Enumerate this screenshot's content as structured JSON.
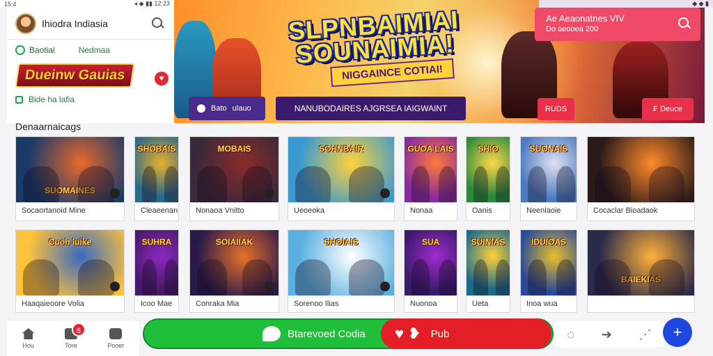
{
  "status_left": {
    "time": "15:4",
    "icons": "◂ ◆ ▮▮ 12:23"
  },
  "status_right": {
    "icons": "◆ ◆ ▮"
  },
  "header": {
    "app_title": "Ihiodra Indiasia"
  },
  "left_panel": {
    "row1_label": "Baotial",
    "row1_secondary": "Nedmaa",
    "logo_text": "Dueinw Gauias",
    "row3_label": "Bide ha lafia"
  },
  "hero": {
    "title_line1": "SLPNBAIMIAI",
    "title_line2": "SOUNAIMIA!",
    "subtitle": "NIGGAINCE COTIAI!",
    "tag_label": "Bato",
    "tag_secondary": "ulauo",
    "info_text": "NANUBODAIRES AJGRSEA IAIGWAINT",
    "button1_label": "RUDS",
    "button2_label": "Deuce",
    "accent_color": "#e8304a"
  },
  "right_search": {
    "line1": "Ae Aeaonatnes VIV",
    "line2": "Do aeooea 200"
  },
  "section_title": "Denaarnaicags",
  "cards_row1": [
    {
      "label": "Socaortanoid Mine",
      "thumb_title": "SUOMAINES"
    },
    {
      "label": "Cleaeenan",
      "thumb_title": "SHOBAIS"
    },
    {
      "label": "Nonaoa Vnitto",
      "thumb_title": "MOBAIS"
    },
    {
      "label": "Ueoeoka",
      "thumb_title": "SOHNBAIR"
    },
    {
      "label": "Nonaa",
      "thumb_title": "GUOA LAIS"
    },
    {
      "label": "Oanis",
      "thumb_title": "SHIO"
    },
    {
      "label": "Neenlaoie",
      "thumb_title": "SUONAIS"
    },
    {
      "label": "Cocaclar Bioadaok",
      "thumb_title": ""
    }
  ],
  "cards_row2": [
    {
      "label": "Haaqaieoore Volia",
      "thumb_title": "Cuoh luike"
    },
    {
      "label": "Icoo Mae",
      "thumb_title": "SUHRA"
    },
    {
      "label": "Conraka Mia",
      "thumb_title": "SOIAIIAK"
    },
    {
      "label": "Sorenoo Ilias",
      "thumb_title": "SHOIAIS"
    },
    {
      "label": "Nuonoa",
      "thumb_title": "SUA"
    },
    {
      "label": "Ueta",
      "thumb_title": "SUINIAS"
    },
    {
      "label": "Inoa wua",
      "thumb_title": "IDUIOAS"
    },
    {
      "label": "",
      "thumb_title": "BAIEKIAS"
    }
  ],
  "bottom_nav": {
    "home_label": "Hou",
    "tv_label": "Tore",
    "tv_badge": "8",
    "camera_label": "Pooer"
  },
  "cta": {
    "green_label": "Btarevoed Codia",
    "red_label": "Pub",
    "green_color": "#1fbf3a",
    "red_color": "#e31e24"
  },
  "fab_label": "+"
}
